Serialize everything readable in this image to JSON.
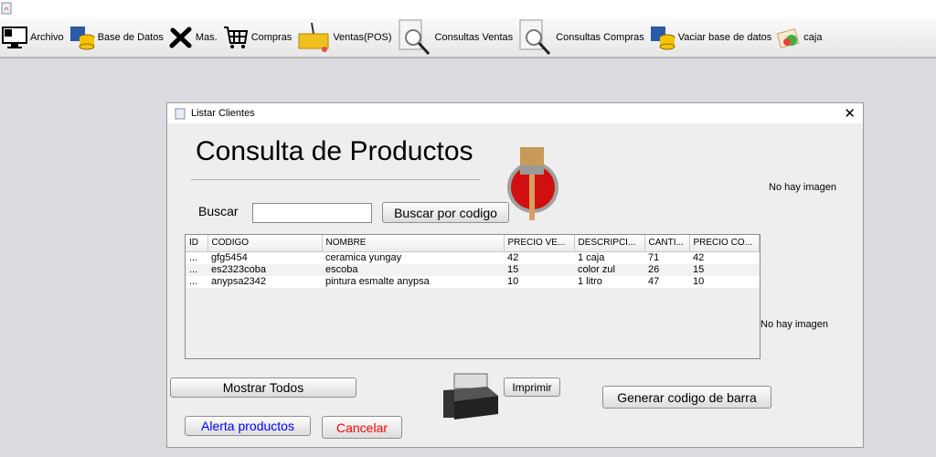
{
  "toolbar": {
    "items": [
      {
        "label": "Archivo",
        "icon": "monitor-icon"
      },
      {
        "label": "Base de Datos",
        "icon": "database-icon"
      },
      {
        "label": "Mas.",
        "icon": "tools-icon"
      },
      {
        "label": "Compras",
        "icon": "cart-icon"
      },
      {
        "label": "Ventas(POS)",
        "icon": "basket-icon"
      },
      {
        "label": "Consultas Ventas",
        "icon": "document-search-icon"
      },
      {
        "label": "Consultas Compras",
        "icon": "document-search-icon"
      },
      {
        "label": "Vaciar base de datos",
        "icon": "database-icon"
      },
      {
        "label": "caja",
        "icon": "cash-icon"
      }
    ]
  },
  "dialog": {
    "title": "Listar Clientes",
    "heading": "Consulta de Productos",
    "search_label": "Buscar",
    "search_value": "",
    "search_button": "Buscar por codigo",
    "no_image_1": "No hay imagen",
    "no_image_2": "No hay imagen",
    "table": {
      "columns": [
        "ID",
        "CODIGO",
        "NOMBRE",
        "PRECIO VE...",
        "DESCRIPCI...",
        "CANTI...",
        "PRECIO CO..."
      ],
      "rows": [
        [
          "...",
          "gfg5454",
          "ceramica yungay",
          "42",
          "1 caja",
          "71",
          "42"
        ],
        [
          "...",
          "es2323coba",
          "escoba",
          "15",
          "color zul",
          "26",
          "15"
        ],
        [
          "...",
          "anypsa2342",
          "pintura esmalte anypsa",
          "10",
          "1 litro",
          "47",
          "10"
        ]
      ]
    },
    "buttons": {
      "show_all": "Mostrar Todos",
      "print": "Imprimir",
      "barcode": "Generar  codigo de barra",
      "alert": "Alerta productos",
      "cancel": "Cancelar"
    },
    "colors": {
      "alert": "#0000ff",
      "cancel": "#ff0000"
    }
  }
}
